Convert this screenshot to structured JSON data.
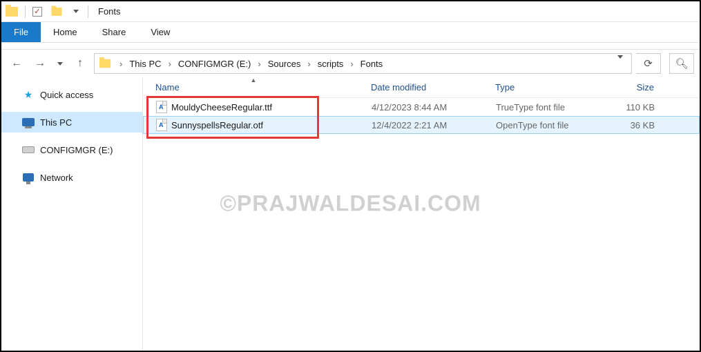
{
  "titlebar": {
    "title": "Fonts"
  },
  "ribbon": {
    "file": "File",
    "home": "Home",
    "share": "Share",
    "view": "View"
  },
  "breadcrumbs": [
    "This PC",
    "CONFIGMGR (E:)",
    "Sources",
    "scripts",
    "Fonts"
  ],
  "sidebar": {
    "items": [
      {
        "label": "Quick access",
        "icon": "star"
      },
      {
        "label": "This PC",
        "icon": "pc",
        "selected": true
      },
      {
        "label": "CONFIGMGR (E:)",
        "icon": "drive"
      },
      {
        "label": "Network",
        "icon": "net"
      }
    ]
  },
  "columns": {
    "name": "Name",
    "date": "Date modified",
    "type": "Type",
    "size": "Size"
  },
  "rows": [
    {
      "name": "MouldyCheeseRegular.ttf",
      "date": "4/12/2023 8:44 AM",
      "type": "TrueType font file",
      "size": "110 KB"
    },
    {
      "name": "SunnyspellsRegular.otf",
      "date": "12/4/2022 2:21 AM",
      "type": "OpenType font file",
      "size": "36 KB"
    }
  ],
  "watermark": "©PRAJWALDESAI.COM"
}
